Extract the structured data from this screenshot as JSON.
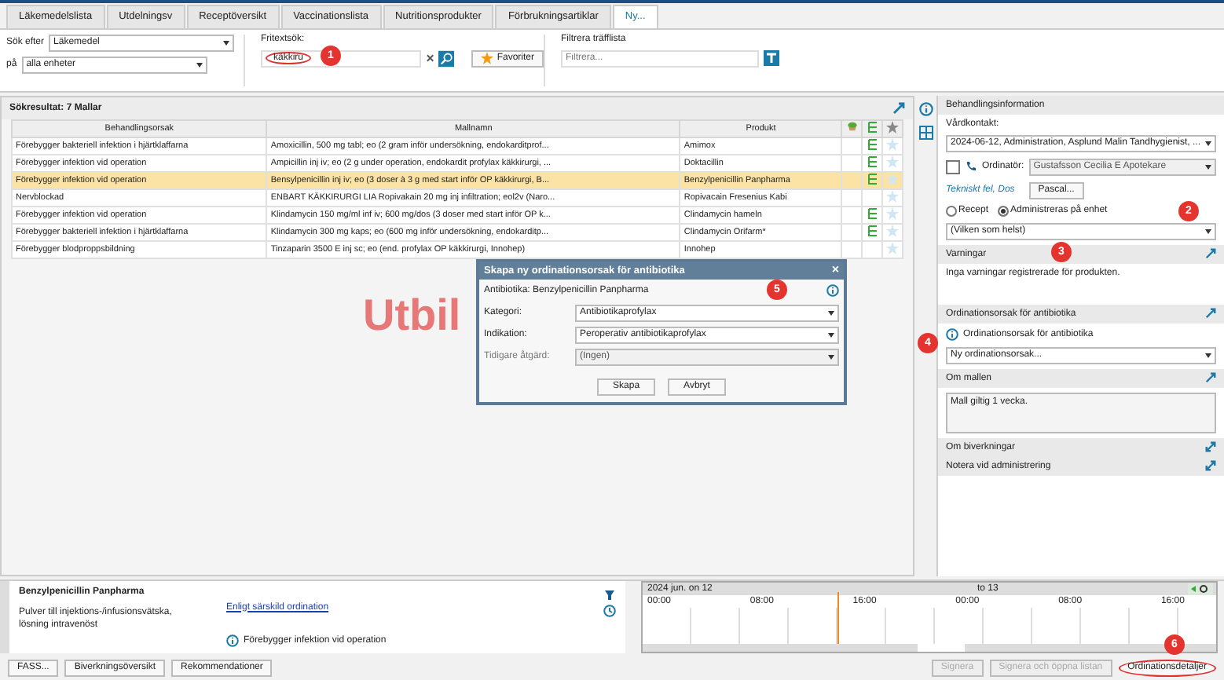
{
  "tabs": [
    {
      "label": "Läkemedelslista",
      "selected": false
    },
    {
      "label": "Utdelningsv",
      "selected": false
    },
    {
      "label": "Receptöversikt",
      "selected": false
    },
    {
      "label": "Vaccinationslista",
      "selected": false
    },
    {
      "label": "Nutritionsprodukter",
      "selected": false
    },
    {
      "label": "Förbrukningsartiklar",
      "selected": false
    },
    {
      "label": "Ny...",
      "selected": true
    }
  ],
  "search": {
    "search_for_label": "Sök efter",
    "search_for_value": "Läkemedel",
    "in_label": "på",
    "in_value": "alla enheter",
    "freetext_label": "Fritextsök:",
    "freetext_value": "käkkiru",
    "freetext_circled": true,
    "freetext_callout": "1",
    "favorites_button": "Favoriter",
    "filter_label": "Filtrera träfflista",
    "filter_placeholder": "Filtrera..."
  },
  "results": {
    "title": "Sökresultat: 7 Mallar",
    "columns": [
      "Behandlingsorsak",
      "Mallnamn",
      "Produkt"
    ],
    "rows": [
      {
        "reason": "Förebygger bakteriell infektion i hjärtklaffarna",
        "template": "Amoxicillin, 500 mg tabl; eo (2 gram inför undersökning, endokarditprof...",
        "product": "Amimox",
        "linked": true,
        "selected": false
      },
      {
        "reason": "Förebygger infektion vid operation",
        "template": "Ampicillin inj iv; eo (2 g under operation, endokardit profylax käkkirurgi, ...",
        "product": "Doktacillin",
        "linked": true,
        "selected": false
      },
      {
        "reason": "Förebygger infektion vid operation",
        "template": "Bensylpenicillin inj iv; eo (3 doser à 3 g med start inför OP käkkirurgi, B...",
        "product": "Benzylpenicillin Panpharma",
        "linked": true,
        "selected": true
      },
      {
        "reason": "Nervblockad",
        "template": "ENBART KÄKKIRURGI LIA Ropivakain 20 mg inj infiltration; eol2v (Naro...",
        "product": "Ropivacain Fresenius Kabi",
        "linked": false,
        "selected": false
      },
      {
        "reason": "Förebygger infektion vid operation",
        "template": "Klindamycin 150 mg/ml inf iv; 600 mg/dos (3 doser med start inför OP k...",
        "product": "Clindamycin hameln",
        "linked": true,
        "selected": false
      },
      {
        "reason": "Förebygger bakteriell infektion i hjärtklaffarna",
        "template": "Klindamycin 300 mg kaps; eo (600 mg inför undersökning, endokarditp...",
        "product": "Clindamycin Orifarm*",
        "linked": true,
        "selected": false
      },
      {
        "reason": "Förebygger blodproppsbildning",
        "template": "Tinzaparin 3500 E inj sc; eo (end. profylax OP käkkirurgi, Innohep)",
        "product": "Innohep",
        "linked": false,
        "selected": false
      }
    ]
  },
  "watermark": "Utbil",
  "dialog": {
    "title": "Skapa ny ordinationsorsak för antibiotika",
    "close": "×",
    "subtitle": "Antibiotika: Benzylpenicillin Panpharma",
    "callout": "5",
    "fields": [
      {
        "label": "Kategori:",
        "value": "Antibiotikaprofylax",
        "disabled": false
      },
      {
        "label": "Indikation:",
        "value": "Peroperativ antibiotikaprofylax",
        "disabled": false
      },
      {
        "label": "Tidigare åtgärd:",
        "value": "(Ingen)",
        "disabled": true
      }
    ],
    "buttons": [
      "Skapa",
      "Avbryt"
    ]
  },
  "treatment": {
    "title": "Behandlingsinformation",
    "contact_label": "Vårdkontakt:",
    "contact_value": "2024-06-12, Administration, Asplund Malin Tandhygienist, ...",
    "prescriber_checked": false,
    "prescriber_label": "Ordinatör:",
    "prescriber_value": "Gustafsson Cecilia E Apotekare",
    "tech_link": "Tekniskt fel, Dos",
    "pascal_button": "Pascal...",
    "radios": [
      {
        "label": "Recept",
        "selected": false
      },
      {
        "label": "Administreras på enhet",
        "selected": true
      }
    ],
    "radios_callout": "2",
    "any_value": "(Vilken som helst)",
    "warnings_title": "Varningar",
    "warnings_callout": "3",
    "warnings_text": "Inga varningar registrerade för produkten.",
    "reason_title": "Ordinationsorsak för antibiotika",
    "reason_label": "Ordinationsorsak för antibiotika",
    "reason_value": "Ny ordinationsorsak...",
    "reason_callout": "4",
    "about_title": "Om mallen",
    "about_text": "Mall giltig 1 vecka.",
    "side_effects_title": "Om biverkningar",
    "note_title": "Notera vid administrering"
  },
  "detail": {
    "product": "Benzylpenicillin Panpharma",
    "form": "Pulver till injektions-/infusionsvätska, lösning intravenöst",
    "dosage_link": "Enligt särskild ordination",
    "indication": "Förebygger infektion vid operation"
  },
  "timeline": {
    "day1": "2024 jun. on 12",
    "day2": "to 13",
    "times": [
      "00:00",
      "08:00",
      "16:00",
      "00:00",
      "08:00",
      "16:00"
    ]
  },
  "footer": {
    "left_buttons": [
      {
        "label": "FASS...",
        "disabled": false
      },
      {
        "label": "Biverkningsöversikt",
        "disabled": false
      },
      {
        "label": "Rekommendationer",
        "disabled": false
      }
    ],
    "right_buttons": [
      {
        "label": "Signera",
        "disabled": true,
        "circled": false
      },
      {
        "label": "Signera och öppna listan",
        "disabled": true,
        "circled": false
      },
      {
        "label": "Ordinationsdetaljer",
        "disabled": false,
        "circled": true
      }
    ],
    "callout": "6"
  }
}
